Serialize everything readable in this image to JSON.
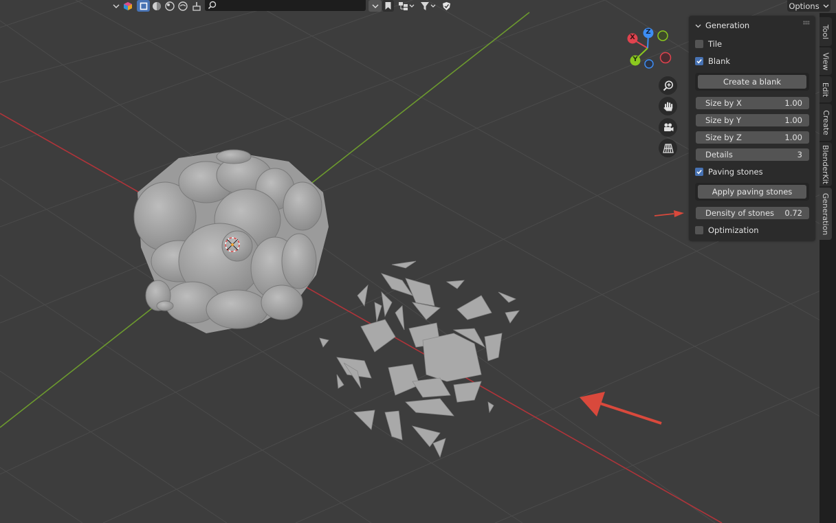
{
  "header": {
    "options_label": "Options",
    "search_value": ""
  },
  "gizmo": {
    "x_label": "X",
    "y_label": "Y",
    "z_label": "Z",
    "colors": {
      "x": "#e0434e",
      "y": "#8bc81f",
      "z": "#3d8df3"
    }
  },
  "panel": {
    "title": "Generation",
    "tile_label": "Tile",
    "tile_checked": false,
    "blank_label": "Blank",
    "blank_checked": true,
    "create_blank_label": "Create a blank",
    "size_x": {
      "label": "Size by X",
      "value": "1.00"
    },
    "size_y": {
      "label": "Size by Y",
      "value": "1.00"
    },
    "size_z": {
      "label": "Size by Z",
      "value": "1.00"
    },
    "details": {
      "label": "Details",
      "value": "3"
    },
    "paving_label": "Paving stones",
    "paving_checked": true,
    "apply_paving_label": "Apply paving stones",
    "density": {
      "label": "Density of stones",
      "value": "0.72"
    },
    "optimization_label": "Optimization",
    "optimization_checked": false
  },
  "tabs": [
    "Tool",
    "View",
    "Edit",
    "Create",
    "BlenderKit",
    "Generation"
  ],
  "active_tab": "Generation",
  "colors": {
    "accent": "#4772b3",
    "annotation_arrow": "#d9493c",
    "axis_x": "#b0343a",
    "axis_y": "#6d9b2e"
  }
}
